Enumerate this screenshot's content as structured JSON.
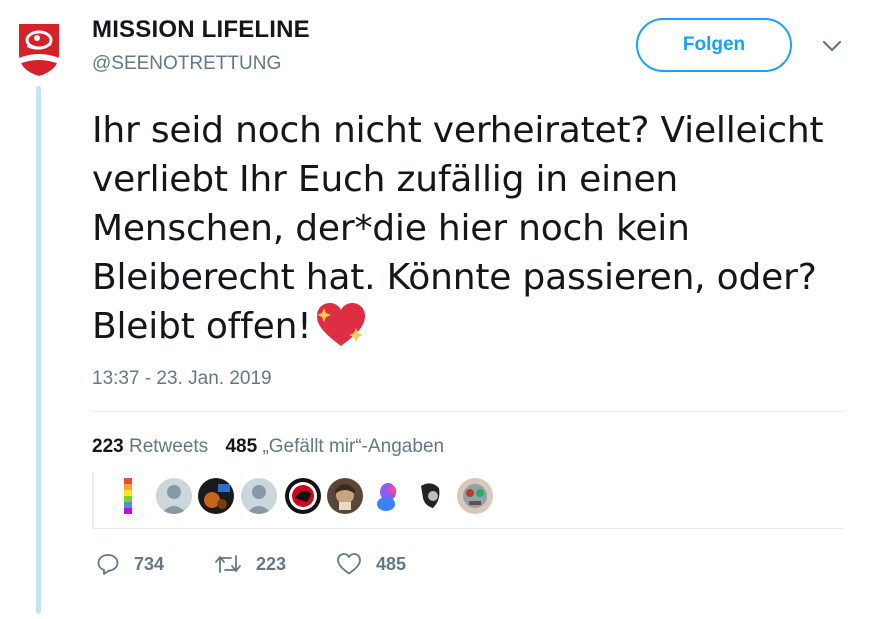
{
  "author": {
    "name": "MISSION LIFELINE",
    "handle": "@SEENOTRETTUNG"
  },
  "follow_label": "Folgen",
  "tweet": {
    "text": "Ihr seid noch nicht verheiratet? Vielleicht verliebt Ihr Euch zufällig in einen Menschen, der*die hier noch kein Bleiberecht hat. Könnte passieren, oder? Bleibt offen!",
    "emoji": "sparkling-heart-icon",
    "timestamp": "13:37 - 23. Jan. 2019"
  },
  "stats": {
    "retweets_count": "223",
    "retweets_label": "Retweets",
    "likes_count": "485",
    "likes_label": "„Gefällt mir“-Angaben"
  },
  "actions": {
    "replies": "734",
    "retweets": "223",
    "likes": "485"
  },
  "colors": {
    "accent": "#1da1f2",
    "brand_red": "#d6202a",
    "secondary_text": "#657786",
    "thread_line": "#c4e4f7"
  }
}
